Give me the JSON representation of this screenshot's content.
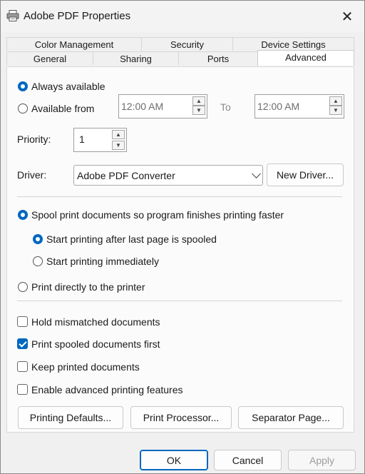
{
  "window": {
    "title": "Adobe PDF Properties"
  },
  "tabs_row1": [
    {
      "label": "Color Management"
    },
    {
      "label": "Security"
    },
    {
      "label": "Device Settings"
    }
  ],
  "tabs_row2": [
    {
      "label": "General"
    },
    {
      "label": "Sharing"
    },
    {
      "label": "Ports"
    },
    {
      "label": "Advanced"
    }
  ],
  "availability": {
    "always_label": "Always available",
    "from_label": "Available from",
    "from_time": "12:00 AM",
    "to_label": "To",
    "to_time": "12:00 AM",
    "selected": "always"
  },
  "priority": {
    "label": "Priority:",
    "value": "1"
  },
  "driver": {
    "label": "Driver:",
    "value": "Adobe PDF Converter",
    "new_driver_button": "New Driver..."
  },
  "spooling": {
    "spool_label": "Spool print documents so program finishes printing faster",
    "after_last_page_label": "Start printing after last page is spooled",
    "immediately_label": "Start printing immediately",
    "direct_label": "Print directly to the printer"
  },
  "options": {
    "hold_mismatched": {
      "label": "Hold mismatched documents",
      "checked": false
    },
    "print_spooled_first": {
      "label": "Print spooled documents first",
      "checked": true
    },
    "keep_printed": {
      "label": "Keep printed documents",
      "checked": false
    },
    "advanced_features": {
      "label": "Enable advanced printing features",
      "checked": false
    }
  },
  "buttons": {
    "printing_defaults": "Printing Defaults...",
    "print_processor": "Print Processor...",
    "separator_page": "Separator Page...",
    "ok": "OK",
    "cancel": "Cancel",
    "apply": "Apply"
  },
  "colors": {
    "accent": "#0067c0"
  }
}
